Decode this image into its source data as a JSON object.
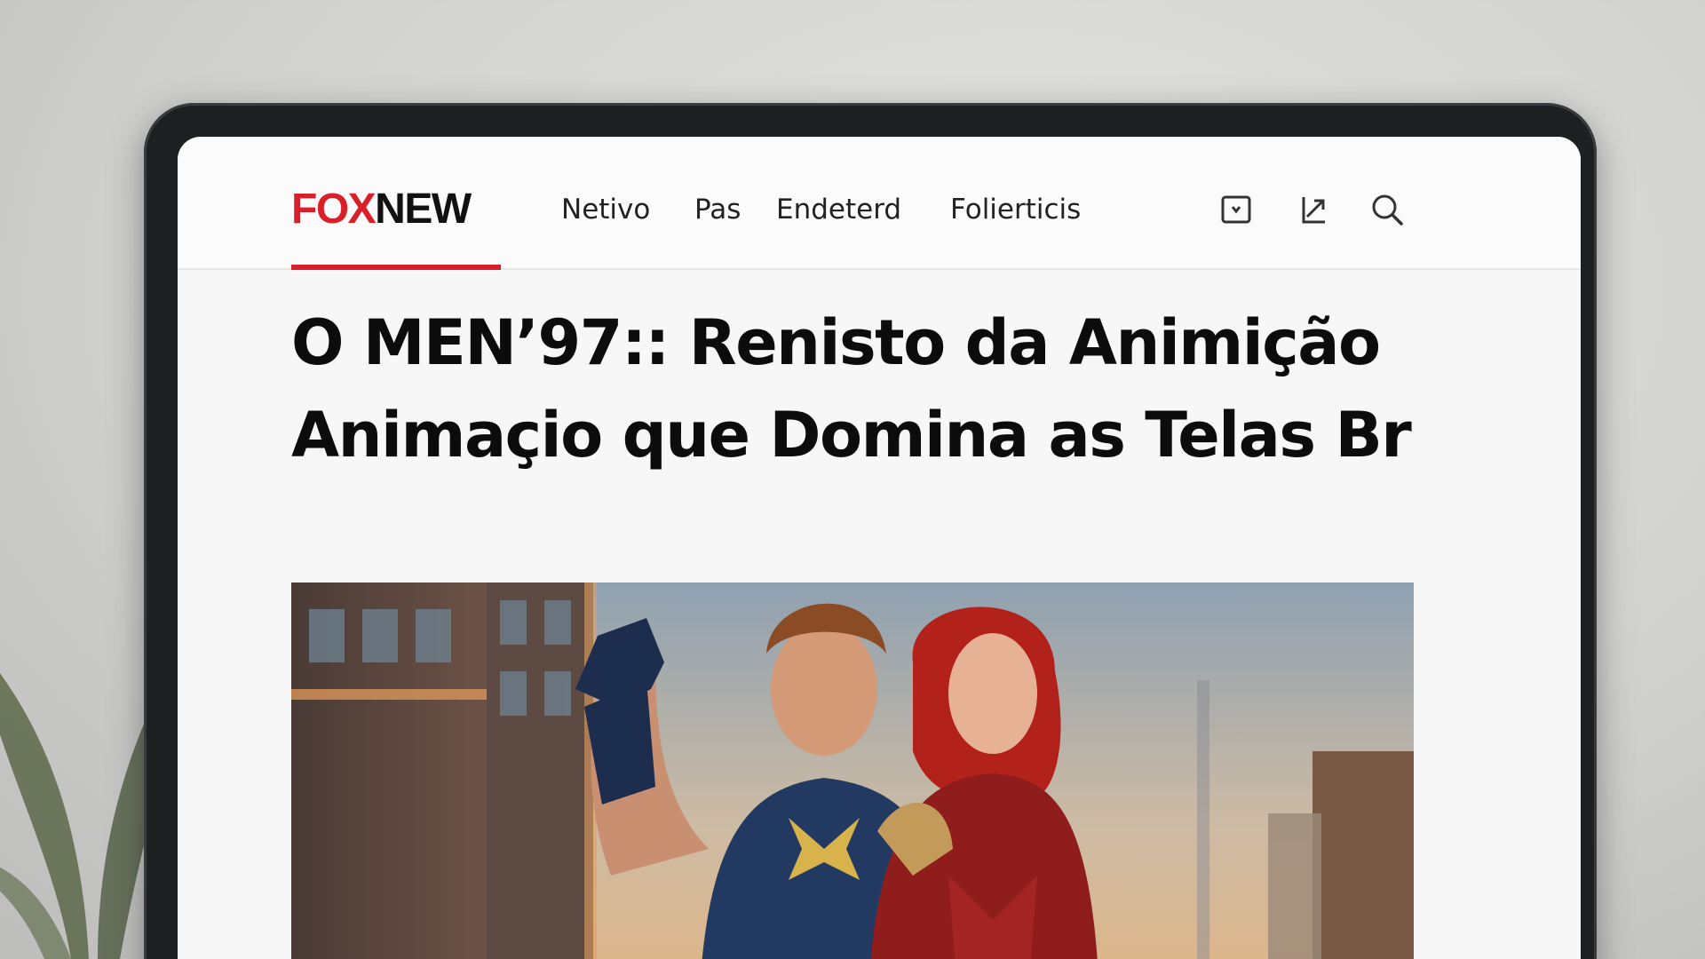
{
  "site": {
    "logo_primary": "FOX",
    "logo_secondary": "NEW",
    "brand_color": "#d8202a"
  },
  "nav": {
    "items": [
      {
        "label": "Netivo"
      },
      {
        "label": "Pas"
      },
      {
        "label": "Endeterd"
      },
      {
        "label": "Folierticis"
      }
    ]
  },
  "header_icons": [
    {
      "name": "bookmark-icon"
    },
    {
      "name": "share-icon"
    },
    {
      "name": "search-icon"
    }
  ],
  "article": {
    "headline_line1": "O MEN’97:: Renisto da Animição",
    "headline_line2": "Animaçio que Domina as Telas Br",
    "hero_image": {
      "subject": "two superheroes in front of city buildings"
    }
  }
}
